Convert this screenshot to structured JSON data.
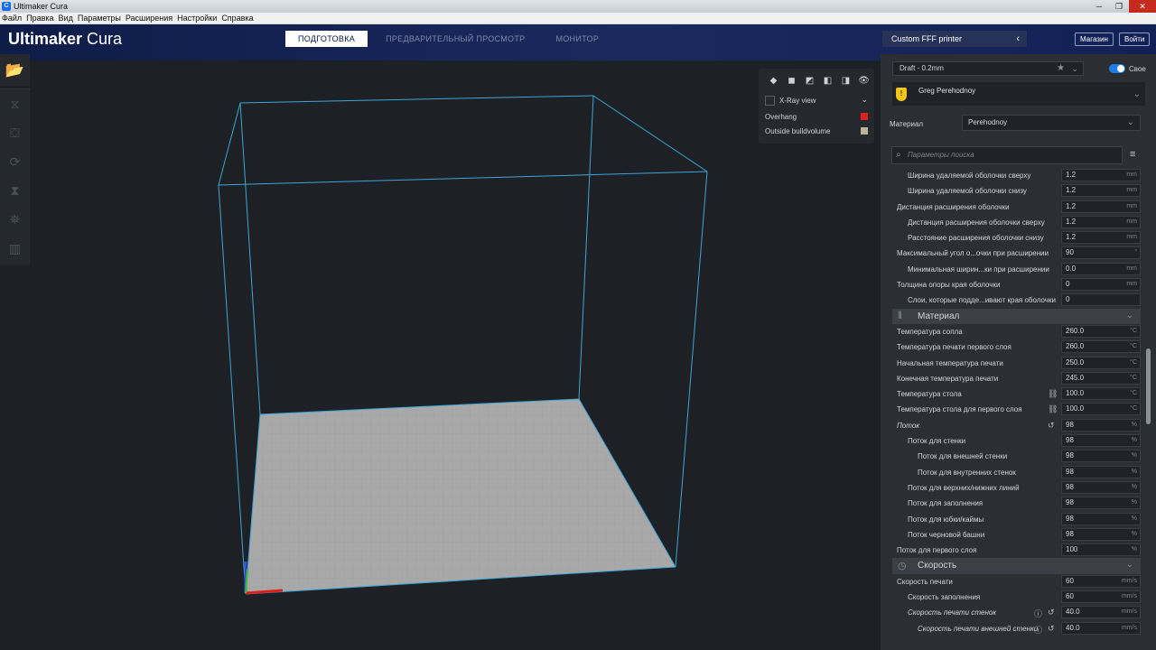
{
  "window": {
    "title": "Ultimaker Cura",
    "app_icon": "cura-icon"
  },
  "menu": [
    "Файл",
    "Правка",
    "Вид",
    "Параметры",
    "Расширения",
    "Настройки",
    "Справка"
  ],
  "header": {
    "logo_bold": "Ultimaker",
    "logo_light": " Cura",
    "tabs": [
      {
        "label": "ПОДГОТОВКА",
        "active": true
      },
      {
        "label": "ПРЕДВАРИТЕЛЬНЫЙ ПРОСМОТР",
        "active": false
      },
      {
        "label": "МОНИТОР",
        "active": false
      }
    ],
    "printer": "Custom FFF printer",
    "store_button": "Магазин",
    "signin_button": "Войти"
  },
  "view_panel": {
    "xray_label": "X-Ray view",
    "overhang_label": "Overhang",
    "outside_label": "Outside buildvolume",
    "overhang_color": "#e0201c",
    "outside_color": "#b8b49a"
  },
  "panel": {
    "profile": "Draft - 0.2mm",
    "toggle_label": "Свое",
    "user_name": "Greg Perehodnoy",
    "material_label": "Материал",
    "material_value": "Perehodnoy",
    "search_placeholder": "Параметры поиска"
  },
  "settings": [
    {
      "type": "row",
      "label": "Ширина удаляемой оболочки сверху",
      "indent": 1,
      "value": "1.2",
      "unit": "mm"
    },
    {
      "type": "row",
      "label": "Ширина удаляемой оболочки снизу",
      "indent": 1,
      "value": "1.2",
      "unit": "mm"
    },
    {
      "type": "row",
      "label": "Дистанция расширения оболочки",
      "indent": 0,
      "value": "1.2",
      "unit": "mm"
    },
    {
      "type": "row",
      "label": "Дистанция расширения оболочки сверху",
      "indent": 1,
      "value": "1.2",
      "unit": "mm"
    },
    {
      "type": "row",
      "label": "Расстояние расширения оболочки снизу",
      "indent": 1,
      "value": "1.2",
      "unit": "mm"
    },
    {
      "type": "row",
      "label": "Максимальный угол о...очки при расширении",
      "indent": 0,
      "value": "90",
      "unit": "°"
    },
    {
      "type": "row",
      "label": "Минимальная ширин...ки при расширении",
      "indent": 1,
      "value": "0.0",
      "unit": "mm"
    },
    {
      "type": "row",
      "label": "Толщина опоры края оболочки",
      "indent": 0,
      "value": "0",
      "unit": "mm"
    },
    {
      "type": "row",
      "label": "Слои, которые подде...ивают края оболочки",
      "indent": 1,
      "value": "0",
      "unit": ""
    },
    {
      "type": "cat",
      "label": "Материал",
      "icon": "material-icon"
    },
    {
      "type": "row",
      "label": "Температура сопла",
      "indent": 0,
      "value": "260.0",
      "unit": "°C"
    },
    {
      "type": "row",
      "label": "Температура печати первого слоя",
      "indent": 0,
      "value": "260.0",
      "unit": "°C"
    },
    {
      "type": "row",
      "label": "Начальная температура печати",
      "indent": 0,
      "value": "250.0",
      "unit": "°C"
    },
    {
      "type": "row",
      "label": "Конечная температура печати",
      "indent": 0,
      "value": "245.0",
      "unit": "°C"
    },
    {
      "type": "row",
      "label": "Температура стола",
      "indent": 0,
      "value": "100.0",
      "unit": "°C",
      "icon": "link-icon"
    },
    {
      "type": "row",
      "label": "Температура стола для первого слоя",
      "indent": 0,
      "value": "100.0",
      "unit": "°C",
      "icon": "link-icon"
    },
    {
      "type": "row",
      "label": "Поток",
      "indent": 0,
      "value": "98",
      "unit": "%",
      "italic": true,
      "icon": "reset-icon"
    },
    {
      "type": "row",
      "label": "Поток для стенки",
      "indent": 1,
      "value": "98",
      "unit": "%"
    },
    {
      "type": "row",
      "label": "Поток для внешней стенки",
      "indent": 2,
      "value": "98",
      "unit": "%"
    },
    {
      "type": "row",
      "label": "Поток для внутренних стенок",
      "indent": 2,
      "value": "98",
      "unit": "%"
    },
    {
      "type": "row",
      "label": "Поток для верхних/нижних линий",
      "indent": 1,
      "value": "98",
      "unit": "%"
    },
    {
      "type": "row",
      "label": "Поток для заполнения",
      "indent": 1,
      "value": "98",
      "unit": "%"
    },
    {
      "type": "row",
      "label": "Поток для юбки/каймы",
      "indent": 1,
      "value": "98",
      "unit": "%"
    },
    {
      "type": "row",
      "label": "Поток черновой башни",
      "indent": 1,
      "value": "98",
      "unit": "%"
    },
    {
      "type": "row",
      "label": "Поток для первого слоя",
      "indent": 0,
      "value": "100",
      "unit": "%"
    },
    {
      "type": "cat",
      "label": "Скорость",
      "icon": "speed-icon"
    },
    {
      "type": "row",
      "label": "Скорость печати",
      "indent": 0,
      "value": "60",
      "unit": "mm/s"
    },
    {
      "type": "row",
      "label": "Скорость заполнения",
      "indent": 1,
      "value": "60",
      "unit": "mm/s"
    },
    {
      "type": "row",
      "label": "Скорость печати стенок",
      "indent": 1,
      "value": "40.0",
      "unit": "mm/s",
      "italic": true,
      "icon": "reset-icon",
      "icon2": "info-icon"
    },
    {
      "type": "row",
      "label": "Скорость печати внешней стенки",
      "indent": 2,
      "value": "40.0",
      "unit": "mm/s",
      "italic": true,
      "icon": "reset-icon",
      "icon2": "info-icon"
    }
  ]
}
